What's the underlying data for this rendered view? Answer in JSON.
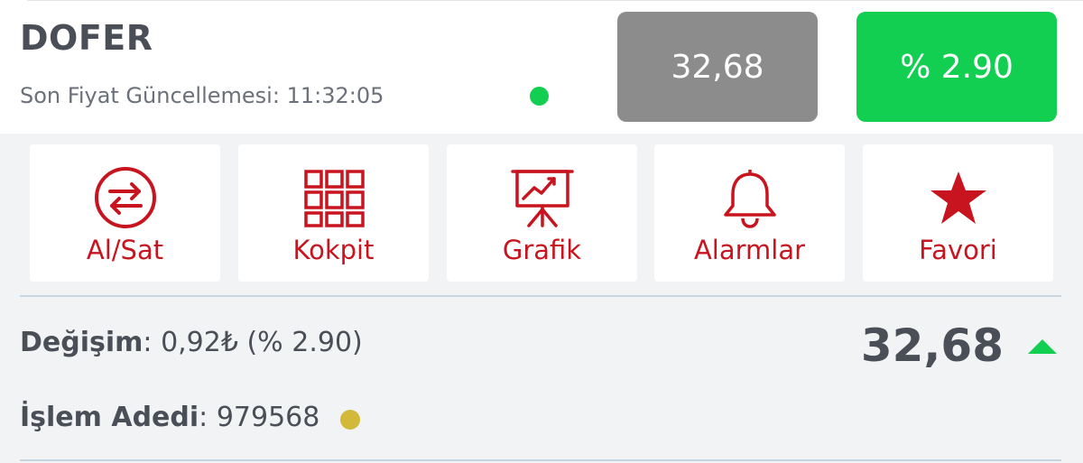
{
  "header": {
    "symbol": "DOFER",
    "last_update_label": "Son Fiyat Güncellemesi:",
    "last_update_time": "11:32:05",
    "price": "32,68",
    "change_percent": "% 2.90"
  },
  "actions": [
    {
      "label": "Al/Sat",
      "icon": "buy-sell-arrows-icon"
    },
    {
      "label": "Kokpit",
      "icon": "grid-icon"
    },
    {
      "label": "Grafik",
      "icon": "chart-presentation-icon"
    },
    {
      "label": "Alarmlar",
      "icon": "bell-icon"
    },
    {
      "label": "Favori",
      "icon": "star-icon"
    }
  ],
  "details": {
    "change_label": "Değişim",
    "change_value": "0,92₺ (% 2.90)",
    "volume_label": "İşlem Adedi",
    "volume_value": "979568",
    "price": "32,68"
  },
  "colors": {
    "accent_red": "#c8141e",
    "up_green": "#12cf52",
    "price_box_gray": "#8c8c8c",
    "indicator_yellow": "#d2b93a"
  }
}
